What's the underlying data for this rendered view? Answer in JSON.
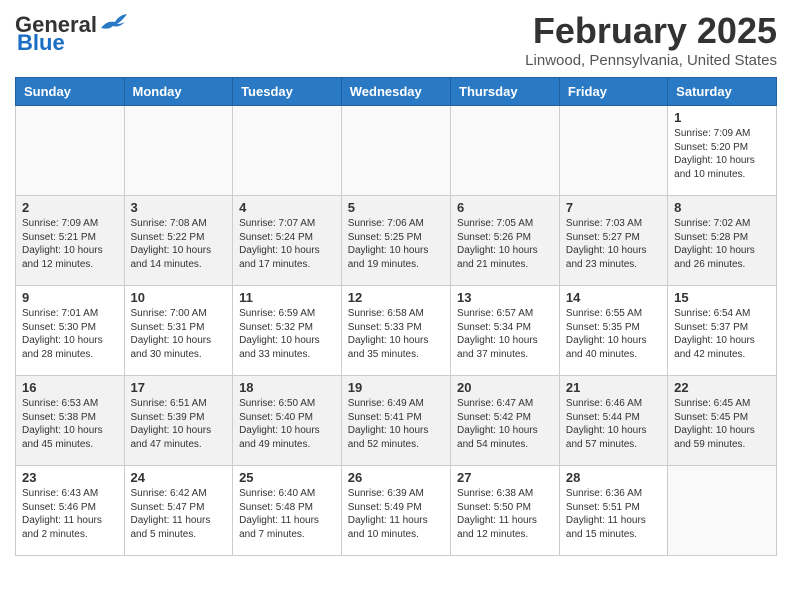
{
  "header": {
    "logo_general": "General",
    "logo_blue": "Blue",
    "month_title": "February 2025",
    "location": "Linwood, Pennsylvania, United States"
  },
  "weekdays": [
    "Sunday",
    "Monday",
    "Tuesday",
    "Wednesday",
    "Thursday",
    "Friday",
    "Saturday"
  ],
  "weeks": [
    [
      {
        "day": "",
        "info": ""
      },
      {
        "day": "",
        "info": ""
      },
      {
        "day": "",
        "info": ""
      },
      {
        "day": "",
        "info": ""
      },
      {
        "day": "",
        "info": ""
      },
      {
        "day": "",
        "info": ""
      },
      {
        "day": "1",
        "info": "Sunrise: 7:09 AM\nSunset: 5:20 PM\nDaylight: 10 hours\nand 10 minutes."
      }
    ],
    [
      {
        "day": "2",
        "info": "Sunrise: 7:09 AM\nSunset: 5:21 PM\nDaylight: 10 hours\nand 12 minutes."
      },
      {
        "day": "3",
        "info": "Sunrise: 7:08 AM\nSunset: 5:22 PM\nDaylight: 10 hours\nand 14 minutes."
      },
      {
        "day": "4",
        "info": "Sunrise: 7:07 AM\nSunset: 5:24 PM\nDaylight: 10 hours\nand 17 minutes."
      },
      {
        "day": "5",
        "info": "Sunrise: 7:06 AM\nSunset: 5:25 PM\nDaylight: 10 hours\nand 19 minutes."
      },
      {
        "day": "6",
        "info": "Sunrise: 7:05 AM\nSunset: 5:26 PM\nDaylight: 10 hours\nand 21 minutes."
      },
      {
        "day": "7",
        "info": "Sunrise: 7:03 AM\nSunset: 5:27 PM\nDaylight: 10 hours\nand 23 minutes."
      },
      {
        "day": "8",
        "info": "Sunrise: 7:02 AM\nSunset: 5:28 PM\nDaylight: 10 hours\nand 26 minutes."
      }
    ],
    [
      {
        "day": "9",
        "info": "Sunrise: 7:01 AM\nSunset: 5:30 PM\nDaylight: 10 hours\nand 28 minutes."
      },
      {
        "day": "10",
        "info": "Sunrise: 7:00 AM\nSunset: 5:31 PM\nDaylight: 10 hours\nand 30 minutes."
      },
      {
        "day": "11",
        "info": "Sunrise: 6:59 AM\nSunset: 5:32 PM\nDaylight: 10 hours\nand 33 minutes."
      },
      {
        "day": "12",
        "info": "Sunrise: 6:58 AM\nSunset: 5:33 PM\nDaylight: 10 hours\nand 35 minutes."
      },
      {
        "day": "13",
        "info": "Sunrise: 6:57 AM\nSunset: 5:34 PM\nDaylight: 10 hours\nand 37 minutes."
      },
      {
        "day": "14",
        "info": "Sunrise: 6:55 AM\nSunset: 5:35 PM\nDaylight: 10 hours\nand 40 minutes."
      },
      {
        "day": "15",
        "info": "Sunrise: 6:54 AM\nSunset: 5:37 PM\nDaylight: 10 hours\nand 42 minutes."
      }
    ],
    [
      {
        "day": "16",
        "info": "Sunrise: 6:53 AM\nSunset: 5:38 PM\nDaylight: 10 hours\nand 45 minutes."
      },
      {
        "day": "17",
        "info": "Sunrise: 6:51 AM\nSunset: 5:39 PM\nDaylight: 10 hours\nand 47 minutes."
      },
      {
        "day": "18",
        "info": "Sunrise: 6:50 AM\nSunset: 5:40 PM\nDaylight: 10 hours\nand 49 minutes."
      },
      {
        "day": "19",
        "info": "Sunrise: 6:49 AM\nSunset: 5:41 PM\nDaylight: 10 hours\nand 52 minutes."
      },
      {
        "day": "20",
        "info": "Sunrise: 6:47 AM\nSunset: 5:42 PM\nDaylight: 10 hours\nand 54 minutes."
      },
      {
        "day": "21",
        "info": "Sunrise: 6:46 AM\nSunset: 5:44 PM\nDaylight: 10 hours\nand 57 minutes."
      },
      {
        "day": "22",
        "info": "Sunrise: 6:45 AM\nSunset: 5:45 PM\nDaylight: 10 hours\nand 59 minutes."
      }
    ],
    [
      {
        "day": "23",
        "info": "Sunrise: 6:43 AM\nSunset: 5:46 PM\nDaylight: 11 hours\nand 2 minutes."
      },
      {
        "day": "24",
        "info": "Sunrise: 6:42 AM\nSunset: 5:47 PM\nDaylight: 11 hours\nand 5 minutes."
      },
      {
        "day": "25",
        "info": "Sunrise: 6:40 AM\nSunset: 5:48 PM\nDaylight: 11 hours\nand 7 minutes."
      },
      {
        "day": "26",
        "info": "Sunrise: 6:39 AM\nSunset: 5:49 PM\nDaylight: 11 hours\nand 10 minutes."
      },
      {
        "day": "27",
        "info": "Sunrise: 6:38 AM\nSunset: 5:50 PM\nDaylight: 11 hours\nand 12 minutes."
      },
      {
        "day": "28",
        "info": "Sunrise: 6:36 AM\nSunset: 5:51 PM\nDaylight: 11 hours\nand 15 minutes."
      },
      {
        "day": "",
        "info": ""
      }
    ]
  ]
}
